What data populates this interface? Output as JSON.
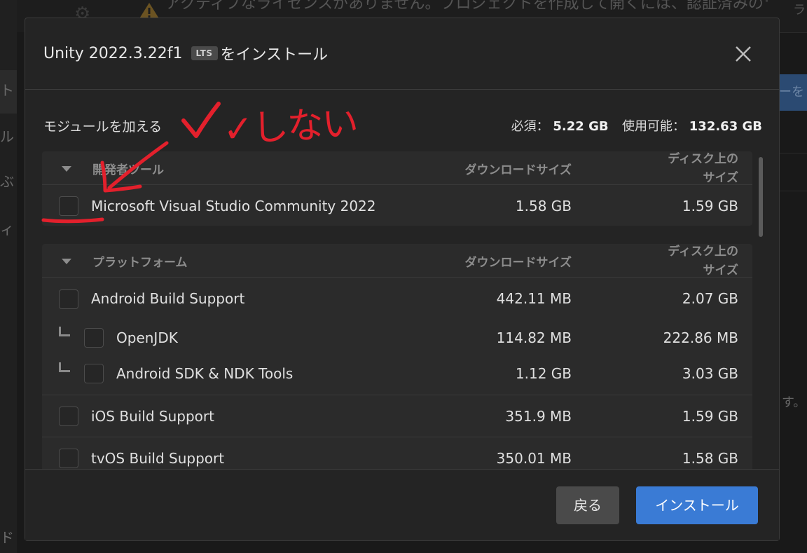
{
  "background": {
    "banner_text": "アクティブなライセンスがありません。プロジェクトを作成して開くには、認証済みのライセンスが必要です。",
    "right_button_text": "ーを",
    "right_top_char": "ラ",
    "right_dot": "す。",
    "sidebar_chars": [
      "ト",
      "ル",
      "ぶ",
      "ィ",
      "ド"
    ]
  },
  "dialog": {
    "title_prefix": "Unity 2022.3.22f1",
    "title_badge": "LTS",
    "title_suffix": "をインストール",
    "modules_label": "モジュールを加える",
    "required_label": "必須：",
    "required_value": "5.22 GB",
    "available_label": "使用可能：",
    "available_value": "132.63 GB",
    "sections": [
      {
        "name": "開発者ツール",
        "col_download": "ダウンロードサイズ",
        "col_disk": "ディスク上の\nサイズ",
        "rows": [
          {
            "name": "Microsoft Visual Studio Community 2022",
            "download": "1.58 GB",
            "disk": "1.59 GB",
            "checked": false
          }
        ]
      },
      {
        "name": "プラットフォーム",
        "col_download": "ダウンロードサイズ",
        "col_disk": "ディスク上の\nサイズ",
        "rows": [
          {
            "name": "Android Build Support",
            "download": "442.11 MB",
            "disk": "2.07 GB",
            "checked": false
          },
          {
            "name": "OpenJDK",
            "download": "114.82 MB",
            "disk": "222.86 MB",
            "checked": false
          },
          {
            "name": "Android SDK & NDK Tools",
            "download": "1.12 GB",
            "disk": "3.03 GB",
            "checked": false
          },
          {
            "name": "iOS Build Support",
            "download": "351.9 MB",
            "disk": "1.59 GB",
            "checked": false
          },
          {
            "name": "tvOS Build Support",
            "download": "350.01 MB",
            "disk": "1.58 GB",
            "checked": false
          }
        ]
      }
    ],
    "back_label": "戻る",
    "install_label": "インストール"
  },
  "annotation": {
    "text": "✓しない",
    "color": "#e3202c"
  }
}
